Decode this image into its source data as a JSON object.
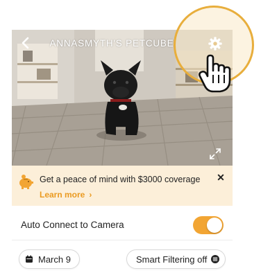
{
  "camera": {
    "title": "ANNASMYTH'S PETCUBE",
    "back_icon": "chevron-left-icon",
    "settings_icon": "gear-icon",
    "expand_icon": "expand-icon"
  },
  "promo": {
    "icon": "piggy-bank-icon",
    "text": "Get a peace of mind with $3000 coverage",
    "link_label": "Learn more",
    "link_chevron": "›",
    "close_label": "✕"
  },
  "auto_connect": {
    "label": "Auto Connect to Camera",
    "enabled": true
  },
  "filters": {
    "date_label": "March 9",
    "date_icon": "calendar-icon",
    "smart_filter_label": "Smart Filtering off",
    "smart_filter_icon": "filter-toggle-icon"
  },
  "colors": {
    "accent": "#f2a533",
    "promo_bg": "#fcefd9",
    "highlight_ring": "#e8ae3c"
  }
}
